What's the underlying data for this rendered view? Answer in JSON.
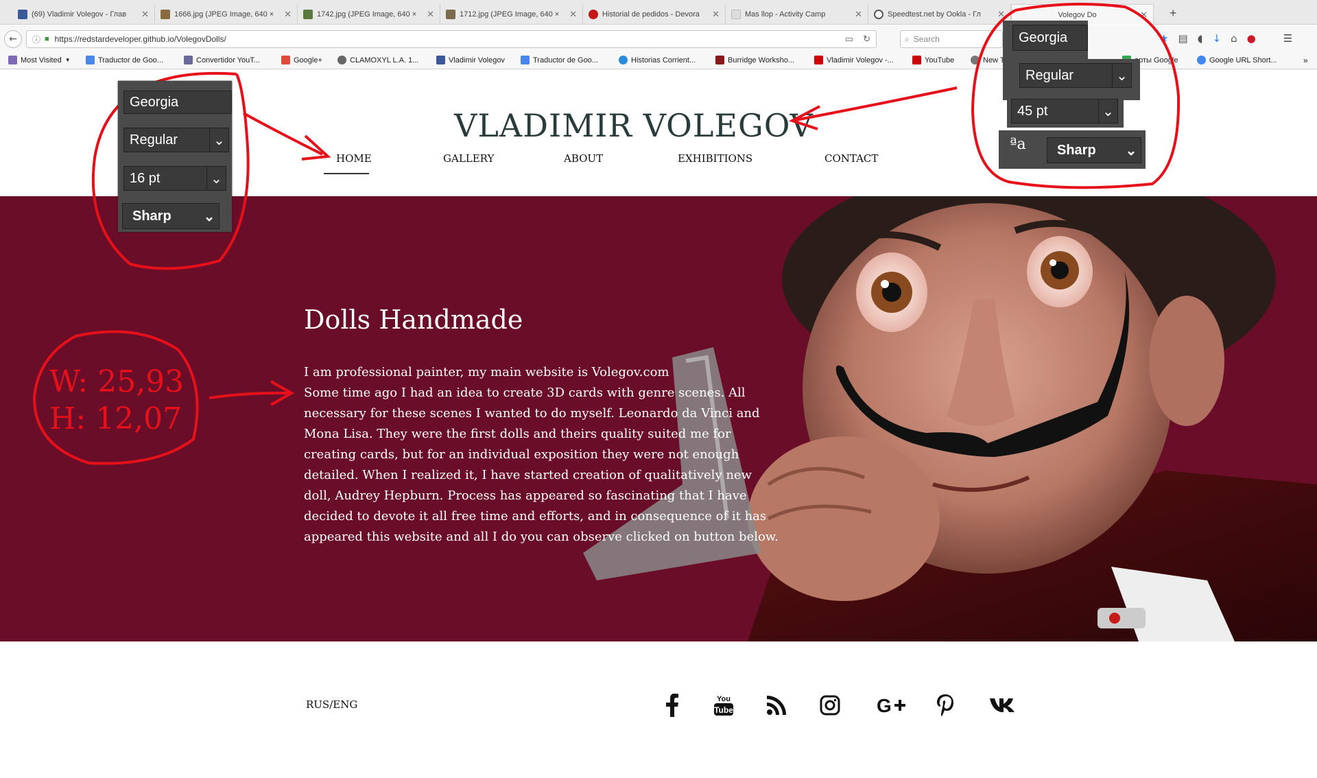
{
  "browser": {
    "tabs": [
      {
        "title": "(69) Vladimir Volegov - Глав",
        "color": "#3b5998"
      },
      {
        "title": "1666.jpg (JPEG Image, 640 ×",
        "color": "#8a6a40"
      },
      {
        "title": "1742.jpg (JPEG Image, 640 ×",
        "color": "#5a7a40"
      },
      {
        "title": "1712.jpg (JPEG Image, 640 ×",
        "color": "#7a6a50"
      },
      {
        "title": "Historial de pedidos - Devora",
        "color": "#c21a1a"
      },
      {
        "title": "Mas llop - Activity Camp",
        "color": "#dddddd"
      },
      {
        "title": "Speedtest.net by Ookla - Гл",
        "color": "#555555"
      },
      {
        "title": "Volegov Do",
        "color": "#eeeeee"
      }
    ],
    "url": "https://redstardeveloper.github.io/VolegovDolls/",
    "search_placeholder": "Search",
    "bookmarks": [
      {
        "label": "Most Visited",
        "color": "#7f6bb5"
      },
      {
        "label": "Traductor de Goo...",
        "color": "#4a86e8"
      },
      {
        "label": "Convertidor YouT...",
        "color": "#6a6a9a"
      },
      {
        "label": "Google+",
        "color": "#dd4b39"
      },
      {
        "label": "CLAMOXYL L.A. 1...",
        "color": "#666666"
      },
      {
        "label": "Vladimir Volegov",
        "color": "#3b5998"
      },
      {
        "label": "Traductor de Goo...",
        "color": "#4a86e8"
      },
      {
        "label": "Historias Corrient...",
        "color": "#2a8ad8"
      },
      {
        "label": "Burridge Worksho...",
        "color": "#8a1a1a"
      },
      {
        "label": "Vladimir Volegov -...",
        "color": "#cc0000"
      },
      {
        "label": "YouTube",
        "color": "#cc0000"
      },
      {
        "label": "New T",
        "color": "#777777"
      },
      {
        "label": "арты Google",
        "color": "#34a853"
      },
      {
        "label": "Google URL Short...",
        "color": "#4285f4"
      }
    ]
  },
  "site": {
    "title": "VLADIMIR VOLEGOV",
    "nav": [
      "HOME",
      "GALLERY",
      "ABOUT",
      "EXHIBITIONS",
      "CONTACT"
    ],
    "hero": {
      "heading": "Dolls Handmade",
      "lines": [
        "I am professional painter, my main website is Volegov.com",
        "Some time ago I had an idea to create 3D cards with genre scenes. All",
        "necessary for these scenes I wanted to do myself. Leonardo da Vinci and",
        "Mona Lisa. They were the first dolls and theirs quality suited me for",
        "creating cards, but for an individual exposition they were not enough",
        "detailed. When I realized it, I have started creation of qualitatively new",
        "doll, Audrey Hepburn. Process has appeared so fascinating that I have",
        "decided to devote it all free time and efforts, and in consequence of it has",
        "appeared this website and all I do you can observe clicked on button below."
      ],
      "background_color": "#6a0d28"
    },
    "footer": {
      "lang": "RUS/ENG",
      "social_icons": [
        "facebook-icon",
        "youtube-icon",
        "rss-icon",
        "instagram-icon",
        "google-plus-icon",
        "pinterest-icon",
        "vk-icon"
      ]
    }
  },
  "annotations": {
    "text_panel": {
      "font": "Georgia",
      "style": "Regular",
      "size": "16 pt",
      "aa": "Sharp"
    },
    "title_panel": {
      "font": "Georgia",
      "style": "Regular",
      "size": "45 pt",
      "aa_glyph": "ªa",
      "aa": "Sharp"
    },
    "dims": {
      "w": "W: 25,93",
      "h": "H: 12,07"
    },
    "color": "#e5101a"
  }
}
